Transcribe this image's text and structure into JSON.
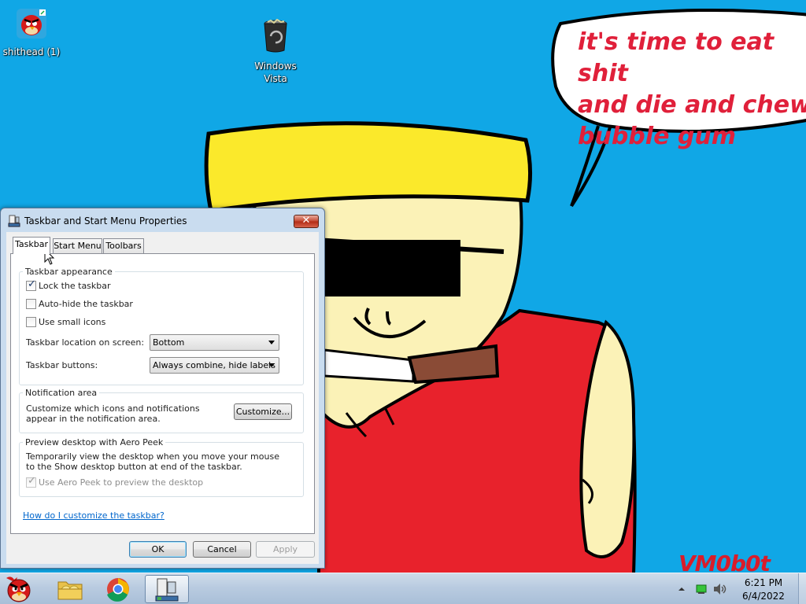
{
  "desktop": {
    "icons": [
      {
        "label": "shithead (1)",
        "icon": "angry-bird-shortcut-icon"
      },
      {
        "label": "Windows\nVista",
        "icon": "recycle-bin-icon"
      }
    ],
    "wallpaper": {
      "speech_bubble_text": "it's time to eat shit\nand die and chew\nbubble gum",
      "signature": "VM0b0t",
      "colors": {
        "background": "#10a7e6",
        "text": "#e0203a",
        "hat": "#fbe92b",
        "shirt": "#e8222c",
        "skin": "#fbf2b7",
        "cigar": "#8a4b36"
      }
    }
  },
  "dialog": {
    "title": "Taskbar and Start Menu Properties",
    "close_label": "✕",
    "tabs": [
      {
        "label": "Taskbar",
        "active": true
      },
      {
        "label": "Start Menu",
        "active": false
      },
      {
        "label": "Toolbars",
        "active": false
      }
    ],
    "taskbar_appearance": {
      "title": "Taskbar appearance",
      "lock_taskbar": {
        "label": "Lock the taskbar",
        "checked": true
      },
      "auto_hide": {
        "label": "Auto-hide the taskbar",
        "checked": false
      },
      "small_icons": {
        "label": "Use small icons",
        "checked": false
      },
      "location_label": "Taskbar location on screen:",
      "location_value": "Bottom",
      "buttons_label": "Taskbar buttons:",
      "buttons_value": "Always combine, hide labels"
    },
    "notification_area": {
      "title": "Notification area",
      "description": "Customize which icons and notifications appear in the notification area.",
      "customize_label": "Customize..."
    },
    "aero_peek": {
      "title": "Preview desktop with Aero Peek",
      "description": "Temporarily view the desktop when you move your mouse to the Show desktop button at end of the taskbar.",
      "use_peek": {
        "label": "Use Aero Peek to preview the desktop",
        "checked": true,
        "enabled": false
      }
    },
    "help_link": "How do I customize the taskbar?",
    "buttons": {
      "ok": "OK",
      "cancel": "Cancel",
      "apply": "Apply"
    }
  },
  "taskbar": {
    "pinned": [
      {
        "name": "angry-birds",
        "icon": "angry-bird-icon"
      },
      {
        "name": "file-explorer",
        "icon": "folder-icon"
      },
      {
        "name": "chrome",
        "icon": "chrome-icon"
      },
      {
        "name": "taskbar-properties",
        "icon": "taskbar-properties-icon",
        "active": true
      }
    ],
    "tray": {
      "time": "6:21 PM",
      "date": "6/4/2022"
    }
  }
}
